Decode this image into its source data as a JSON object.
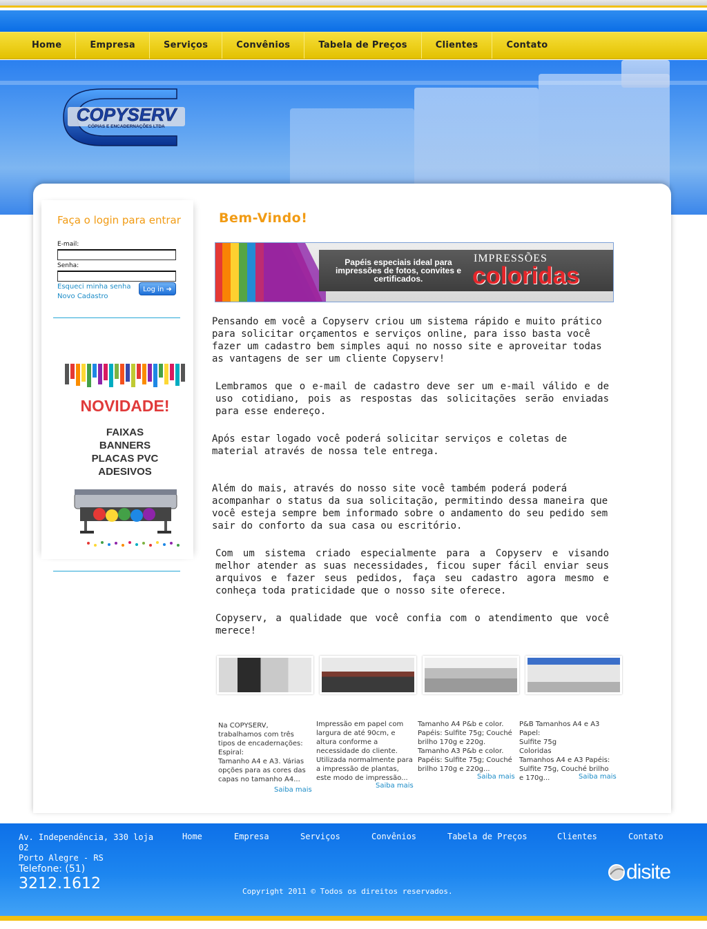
{
  "nav": {
    "items": [
      "Home",
      "Empresa",
      "Serviços",
      "Convênios",
      "Tabela de Preços",
      "Clientes",
      "Contato"
    ]
  },
  "logo": {
    "name": "COPYSERV",
    "tagline": "CÓPIAS E ENCADERNAÇÕES LTDA"
  },
  "login": {
    "title": "Faça o login para entrar",
    "email_label": "E-mail:",
    "email_value": "",
    "password_label": "Senha:",
    "password_value": "",
    "forgot_link": "Esqueci minha senha",
    "register_link": "Novo Cadastro",
    "button_label": "Log in"
  },
  "promo": {
    "headline": "NOVIDADE!",
    "lines": [
      "FAIXAS",
      "BANNERS",
      "PLACAS PVC",
      "ADESIVOS"
    ]
  },
  "main": {
    "title": "Bem-Vindo!",
    "banner": {
      "text": "Papéis especiais ideal para impressões de fotos, convites e certificados.",
      "heading1": "IMPRESSÕES",
      "heading2": "coloridas"
    },
    "paragraphs": [
      " Pensando em você a Copyserv criou um sistema rápido e muito prático para solicitar orçamentos e serviços online, para isso basta você fazer um cadastro bem simples aqui no nosso site e aproveitar todas as vantagens de ser um cliente Copyserv!",
      " Lembramos que o e-mail de cadastro deve ser um e-mail válido e de uso cotidiano, pois as respostas das solicitações serão enviadas para esse endereço.",
      " Após estar logado você poderá solicitar serviços e coletas de material através de nossa tele entrega.",
      " Além do mais, através do nosso site você também poderá poderá acompanhar o status da sua solicitação, permitindo dessa maneira que você esteja sempre bem informado sobre o andamento do seu pedido sem sair do conforto da sua casa ou escritório.",
      " Com um sistema criado especialmente para a Copyserv e visando melhor atender as suas necessidades, ficou super fácil enviar seus arquivos e fazer seus pedidos, faça seu cadastro agora mesmo e conheça toda praticidade que o nosso site oferece.",
      " Copyserv, a qualidade que você confia com o atendimento que você merece!"
    ],
    "services": [
      {
        "caption": "Na COPYSERV, trabalhamos com três tipos de encadernações:\nEspiral:\nTamanho A4 e A3. Várias opções para as cores das capas no tamanho A4...",
        "link": "Saiba mais"
      },
      {
        "caption": "Impressão em papel com largura de até 90cm, e altura conforme a necessidade do cliente. Utilizada normalmente para a impressão de plantas, este modo de impressão...",
        "link": "Saiba mais"
      },
      {
        "caption": "Tamanho A4 P&b e color. Papéis: Sulfite 75g; Couché brilho 170g e 220g.\nTamanho A3 P&b e color. Papéis: Sulfite 75g; Couché brilho 170g e 220g...",
        "link": "Saiba mais"
      },
      {
        "caption": "P&B Tamanhos A4 e A3\nPapel:\nSulfite 75g\nColoridas\nTamanhos A4 e A3 Papéis: Sulfite 75g, Couché brilho  e 170g...",
        "link": "Saiba mais"
      }
    ]
  },
  "footer": {
    "address1": "Av. Independência, 330 loja 02",
    "address2": "Porto Alegre - RS",
    "phone_label": "Telefone: (51)",
    "phone_number": "3212.1612",
    "nav": [
      "Home",
      "Empresa",
      "Serviços",
      "Convênios",
      "Tabela de Preços",
      "Clientes",
      "Contato"
    ],
    "copyright": "Copyright 2011 © Todos os direitos reservados.",
    "credit": "disite"
  },
  "colors": {
    "accent_orange": "#f19b14",
    "nav_yellow": "#eccf1a",
    "brand_blue": "#0a6ee6",
    "link_blue": "#1a8bc7"
  }
}
